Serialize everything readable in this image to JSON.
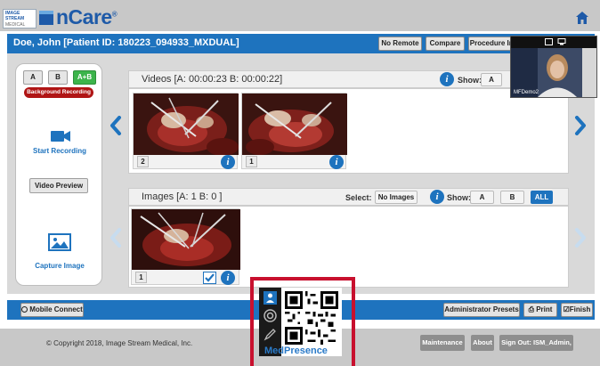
{
  "header": {
    "logo_line1": "IMAGE",
    "logo_line2": "STREAM",
    "logo_line3": "MEDICAL",
    "brand": "nCare",
    "trademark": "®",
    "home_icon": "home-icon"
  },
  "patient_bar": {
    "patient": "Doe, John  [Patient ID: 180223_094933_MXDUAL]",
    "buttons": [
      "No Remote",
      "Compare",
      "Procedure Info"
    ]
  },
  "video_call": {
    "participant": "MFDemo2"
  },
  "left_panel": {
    "source_buttons": [
      "A",
      "B",
      "A+B"
    ],
    "selected_source": "A+B",
    "background_recording": "Background Recording",
    "start_recording": "Start Recording",
    "video_preview": "Video Preview",
    "capture_image": "Capture Image"
  },
  "videos": {
    "title": "Videos [A: 00:00:23   B: 00:00:22]",
    "show_label": "Show:",
    "show_buttons": [
      "A"
    ],
    "items": [
      {
        "badge": "2"
      },
      {
        "badge": "1"
      }
    ]
  },
  "images": {
    "title": "Images [A: 1   B: 0 ]",
    "select_label": "Select:",
    "select_button": "No Images",
    "show_label": "Show:",
    "show_buttons": [
      "A",
      "B",
      "ALL"
    ],
    "selected_show": "ALL",
    "items": [
      {
        "badge": "1",
        "checked": true
      }
    ]
  },
  "bottom_bar": {
    "mobile_connect": "Mobile Connect",
    "administrator_presets": "Administrator Presets",
    "print": "Print",
    "finish": "Finish"
  },
  "footer": {
    "copyright": "© Copyright 2018, Image Stream Medical, Inc.",
    "buttons": [
      "Maintenance",
      "About",
      "Sign Out: ISM_Admin,"
    ]
  },
  "medpresence": {
    "logo": "MedPresence",
    "icons": [
      "people-icon",
      "medpresence-icon",
      "pen-icon"
    ]
  },
  "colors": {
    "primary_blue": "#1e73be",
    "brand_blue": "#1e5aa8",
    "selected_green": "#3cb44b",
    "recording_red": "#b01515",
    "highlight_red": "#c8102e"
  }
}
